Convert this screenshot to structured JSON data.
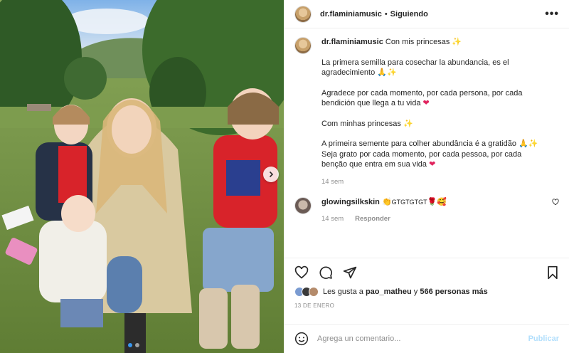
{
  "post": {
    "username": "dr.flaminiamusic",
    "separator": "•",
    "follow_status": "Siguiendo",
    "more_icon": "•••"
  },
  "caption": {
    "username": "dr.flaminiamusic",
    "title": "Con mis princesas",
    "p1": "La primera semilla para cosechar la abundancia, es el agradecimiento",
    "p2": "Agradece por cada momento, por cada persona, por cada bendición que llega a tu vida",
    "p3": "Com minhas princesas",
    "p4": "A primeira semente para colher abundância é a gratidão",
    "p4b": "Seja grato por cada momento, por cada pessoa, por cada benção que entra em sua vida",
    "time": "14 sem"
  },
  "comment": {
    "username": "glowingsilkskin",
    "text": "GTGTGTGT",
    "time": "14 sem",
    "reply": "Responder"
  },
  "likes": {
    "prefix": "Les gusta a",
    "user": "pao_matheu",
    "connector": "y",
    "count": "566 personas más"
  },
  "date": "13 DE ENERO",
  "add_comment": {
    "placeholder": "Agrega un comentario...",
    "publish": "Publicar"
  },
  "icons": [
    "heart-icon",
    "comment-icon",
    "share-icon",
    "save-icon",
    "smiley-icon",
    "chevron-right-icon"
  ],
  "colors": {
    "accent": "#3897f0",
    "publish_disabled": "#b2dffc",
    "muted": "#8e8e8e",
    "heart": "#ed4956"
  }
}
